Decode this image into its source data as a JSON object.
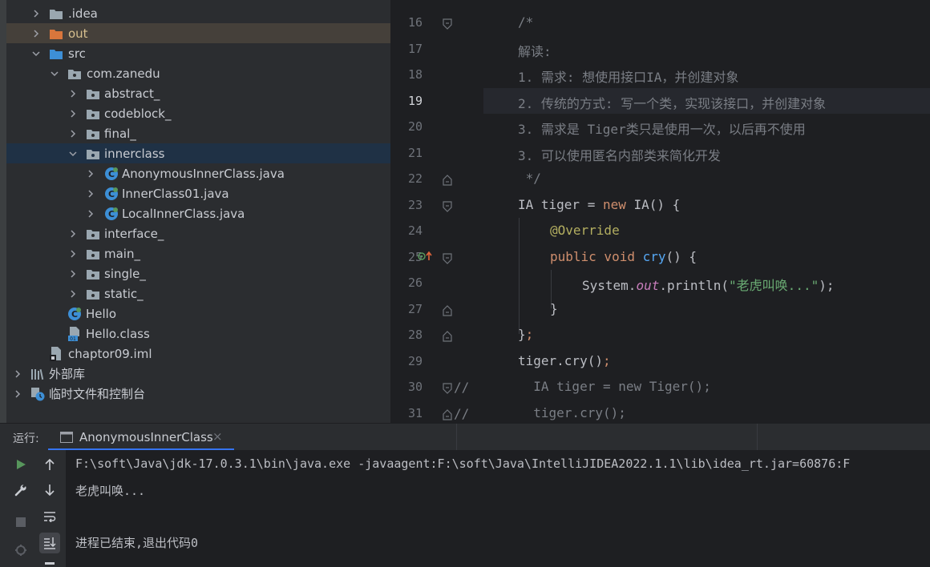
{
  "project_tree": {
    "items": [
      {
        "label": ".idea",
        "icon": "folder-icon"
      },
      {
        "label": "out",
        "icon": "folder-excluded-icon"
      },
      {
        "label": "src",
        "icon": "folder-source-icon"
      },
      {
        "label": "com.zanedu",
        "icon": "package-icon"
      },
      {
        "label": "abstract_",
        "icon": "package-icon"
      },
      {
        "label": "codeblock_",
        "icon": "package-icon"
      },
      {
        "label": "final_",
        "icon": "package-icon"
      },
      {
        "label": "innerclass",
        "icon": "package-icon"
      },
      {
        "label": "AnonymousInnerClass.java",
        "icon": "java-class-icon"
      },
      {
        "label": "InnerClass01.java",
        "icon": "java-class-icon"
      },
      {
        "label": "LocalInnerClass.java",
        "icon": "java-class-icon"
      },
      {
        "label": "interface_",
        "icon": "package-icon"
      },
      {
        "label": "main_",
        "icon": "package-icon"
      },
      {
        "label": "single_",
        "icon": "package-icon"
      },
      {
        "label": "static_",
        "icon": "package-icon"
      },
      {
        "label": "Hello",
        "icon": "java-class-icon"
      },
      {
        "label": "Hello.class",
        "icon": "class-file-icon"
      },
      {
        "label": "chaptor09.iml",
        "icon": "iml-file-icon"
      },
      {
        "label": "外部库",
        "icon": "library-icon"
      },
      {
        "label": "临时文件和控制台",
        "icon": "scratches-icon"
      }
    ]
  },
  "editor": {
    "current_line": "19",
    "line_numbers": [
      "16",
      "17",
      "18",
      "19",
      "20",
      "21",
      "22",
      "23",
      "24",
      "25",
      "26",
      "27",
      "28",
      "29",
      "30",
      "31"
    ],
    "lines": {
      "l16": "/*",
      "l17": "解读:",
      "l18": "1. 需求: 想使用接口IA，并创建对象",
      "l19": "2. 传统的方式: 写一个类，实现该接口，并创建对象",
      "l20": "3. 需求是 Tiger类只是使用一次，以后再不使用",
      "l21": "3. 可以使用匿名内部类来简化开发",
      "l22": " */",
      "l23": {
        "a": "IA tiger = ",
        "kw": "new",
        "b": " IA() {"
      },
      "l24": "@Override",
      "l25": {
        "kw1": "public",
        "kw2": " void ",
        "fn": "cry",
        "b": "() {"
      },
      "l26": {
        "a": "System.",
        "fld": "out",
        "b": ".println(",
        "str": "\"老虎叫唤...\"",
        "c": ");"
      },
      "l27": "}",
      "l28": {
        "a": "}",
        "b": ";"
      },
      "l29": {
        "a": "tiger.cry()",
        "b": ";"
      },
      "l30": "  IA tiger = new Tiger();",
      "l31": "  tiger.cry();",
      "l30_prefix": "//",
      "l31_prefix": "//"
    }
  },
  "run_panel": {
    "label": "运行:",
    "tab_label": "AnonymousInnerClass",
    "close_glyph": "×",
    "console_lines": [
      "F:\\soft\\Java\\jdk-17.0.3.1\\bin\\java.exe -javaagent:F:\\soft\\Java\\IntelliJIDEA2022.1.1\\lib\\idea_rt.jar=60876:F",
      "老虎叫唤...",
      "",
      "进程已结束,退出代码0"
    ]
  },
  "colors": {
    "accent": "#3574f0",
    "run_green": "#57965c",
    "selection": "#1f3145"
  }
}
